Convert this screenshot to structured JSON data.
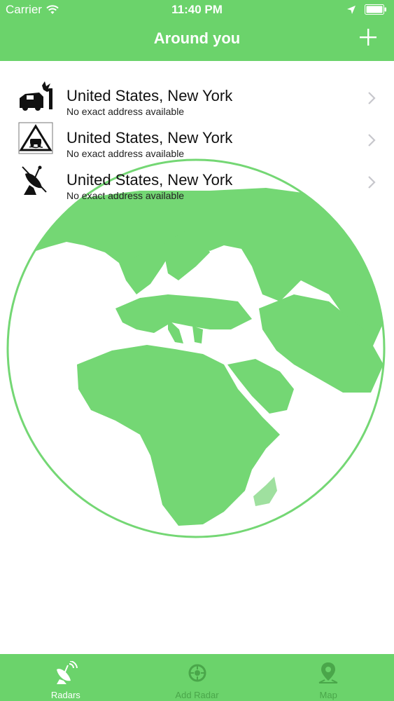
{
  "status_bar": {
    "carrier": "Carrier",
    "time": "11:40 PM"
  },
  "nav": {
    "title": "Around you",
    "add_icon": "plus-icon"
  },
  "radars": [
    {
      "icon": "car-crash-icon",
      "title": "United States, New York",
      "subtitle": "No exact address available"
    },
    {
      "icon": "road-hazard-sign-icon",
      "title": "United States, New York",
      "subtitle": "No exact address available"
    },
    {
      "icon": "radar-dish-icon",
      "title": "United States, New York",
      "subtitle": "No exact address available"
    }
  ],
  "tabs": [
    {
      "label": "Radars",
      "icon": "radar-dish-icon",
      "active": true
    },
    {
      "label": "Add Radar",
      "icon": "add-radar-icon",
      "active": false
    },
    {
      "label": "Map",
      "icon": "map-pin-icon",
      "active": false
    }
  ],
  "colors": {
    "brand_green": "#6bd36b",
    "globe_green": "#74d774",
    "inactive_tab": "#4aa64a"
  }
}
